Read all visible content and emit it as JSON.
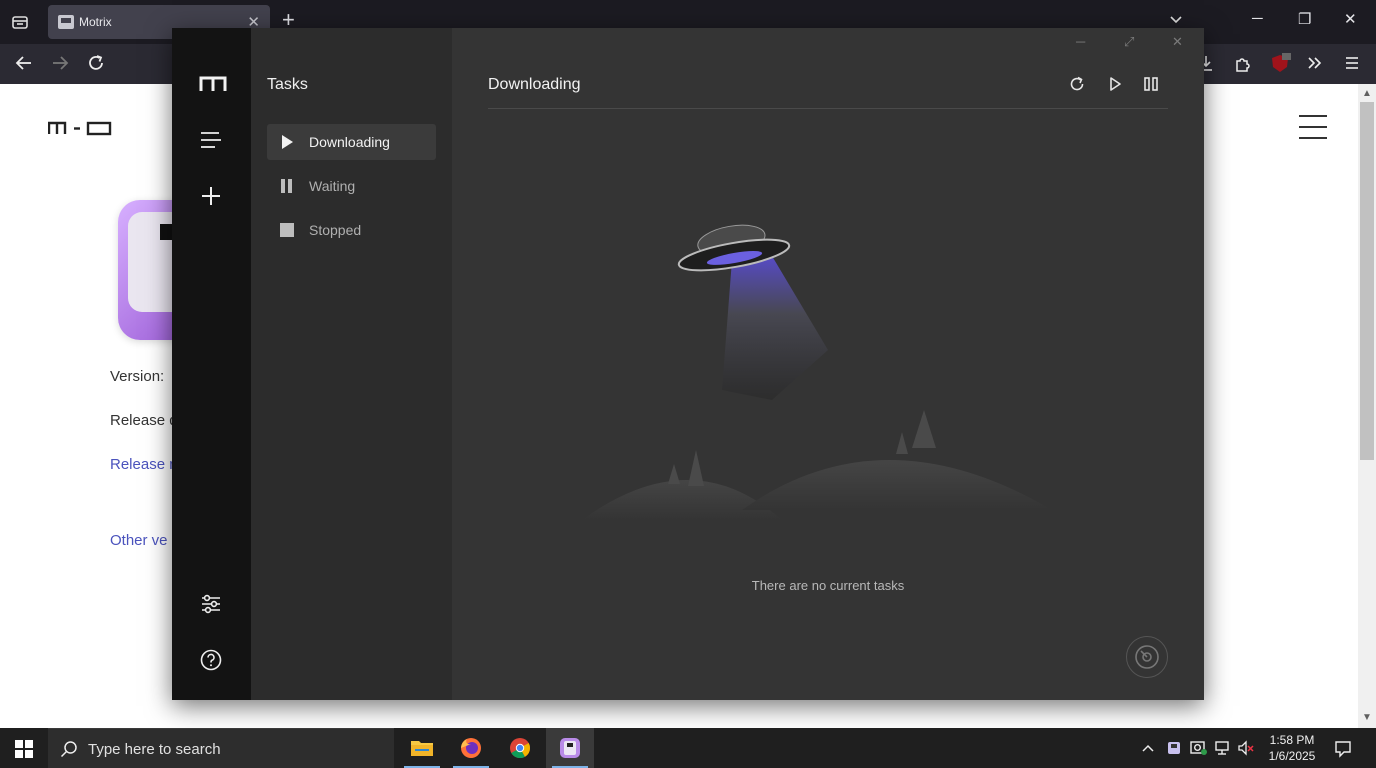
{
  "browser": {
    "tab_title": "Motrix",
    "tab_close": "✕",
    "new_tab": "+",
    "window_controls": {
      "minimize": "─",
      "restore": "❐",
      "close": "✕"
    }
  },
  "webpage": {
    "logo_text": "m-o",
    "version_label": "Version:",
    "release_date_label": "Release d",
    "release_notes_link": "Release n",
    "other_versions_link": "Other ve"
  },
  "motrix": {
    "sidebar_title": "Tasks",
    "task_items": [
      {
        "label": "Downloading",
        "icon": "play-icon",
        "active": true
      },
      {
        "label": "Waiting",
        "icon": "pause-icon",
        "active": false
      },
      {
        "label": "Stopped",
        "icon": "stop-icon",
        "active": false
      }
    ],
    "main_title": "Downloading",
    "empty_message": "There are no current tasks",
    "window_controls": {
      "minimize": "─",
      "maximize": "⤢",
      "close": "✕"
    },
    "actions": [
      "refresh-icon",
      "resume-all-icon",
      "pause-all-icon"
    ]
  },
  "taskbar": {
    "search_placeholder": "Type here to search",
    "time": "1:58 PM",
    "date": "1/6/2025",
    "apps": [
      "file-explorer-icon",
      "firefox-icon",
      "chrome-icon",
      "motrix-icon"
    ]
  },
  "colors": {
    "motrix_main_bg": "#343434",
    "motrix_rail_bg": "#131313",
    "motrix_sub_bg": "#2c2c2c",
    "link_color": "#4b53bd",
    "ufo_beam": "#5b4ed6"
  }
}
